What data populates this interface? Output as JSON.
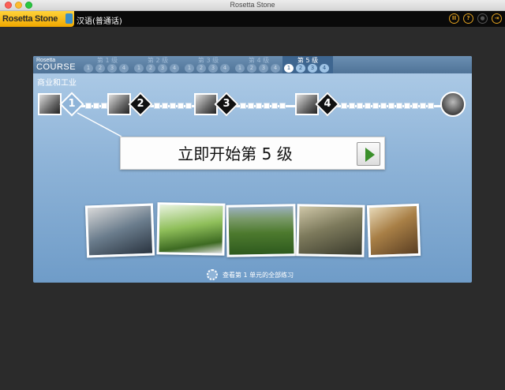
{
  "window": {
    "title": "Rosetta Stone"
  },
  "header": {
    "logo": "Rosetta Stone",
    "language": "汉语(普通话)",
    "icons": [
      "pause-icon",
      "help-icon",
      "record-icon",
      "exit-icon"
    ]
  },
  "course": {
    "logo_small": "Rosetta",
    "logo_big": "COURSE",
    "levels": [
      {
        "label": "第 1 级",
        "units": [
          "1",
          "2",
          "3",
          "4"
        ],
        "active": false
      },
      {
        "label": "第 2 级",
        "units": [
          "1",
          "2",
          "3",
          "4"
        ],
        "active": false
      },
      {
        "label": "第 3 级",
        "units": [
          "1",
          "2",
          "3",
          "4"
        ],
        "active": false
      },
      {
        "label": "第 4 级",
        "units": [
          "1",
          "2",
          "3",
          "4"
        ],
        "active": false
      },
      {
        "label": "第 5 级",
        "units": [
          "1",
          "2",
          "3",
          "4"
        ],
        "active": true,
        "selected_unit": "1"
      }
    ],
    "unit_title": "商业和工业",
    "lessons": [
      "1",
      "2",
      "3",
      "4"
    ],
    "start_text": "立即开始第 5 级",
    "view_all_text": "查看第 1 单元的全部练习"
  },
  "colors": {
    "accent": "#f0a800",
    "panel": "#8fb4d8",
    "play_arrow": "#3a8f2a"
  }
}
